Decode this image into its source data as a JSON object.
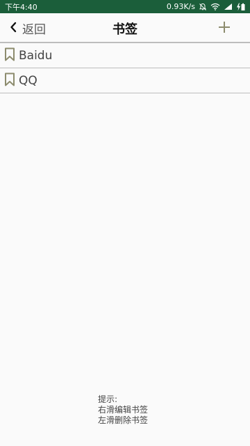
{
  "status_bar": {
    "time": "下午4:40",
    "network_speed": "0.93K/s",
    "icons": [
      "mute-bell-icon",
      "wifi-icon",
      "signal-icon",
      "charging-icon"
    ]
  },
  "toolbar": {
    "back_label": "返回",
    "title": "书签",
    "add_icon": "plus-icon"
  },
  "bookmarks": [
    {
      "label": "Baidu",
      "icon": "bookmark-icon"
    },
    {
      "label": "QQ",
      "icon": "bookmark-icon"
    }
  ],
  "hint": {
    "title": "提示:",
    "line1": "右滑编辑书签",
    "line2": "左滑删除书签"
  },
  "colors": {
    "status_bar": "#1b5e3a",
    "icon_olive": "#8d8c6e",
    "background": "#fafafa"
  }
}
